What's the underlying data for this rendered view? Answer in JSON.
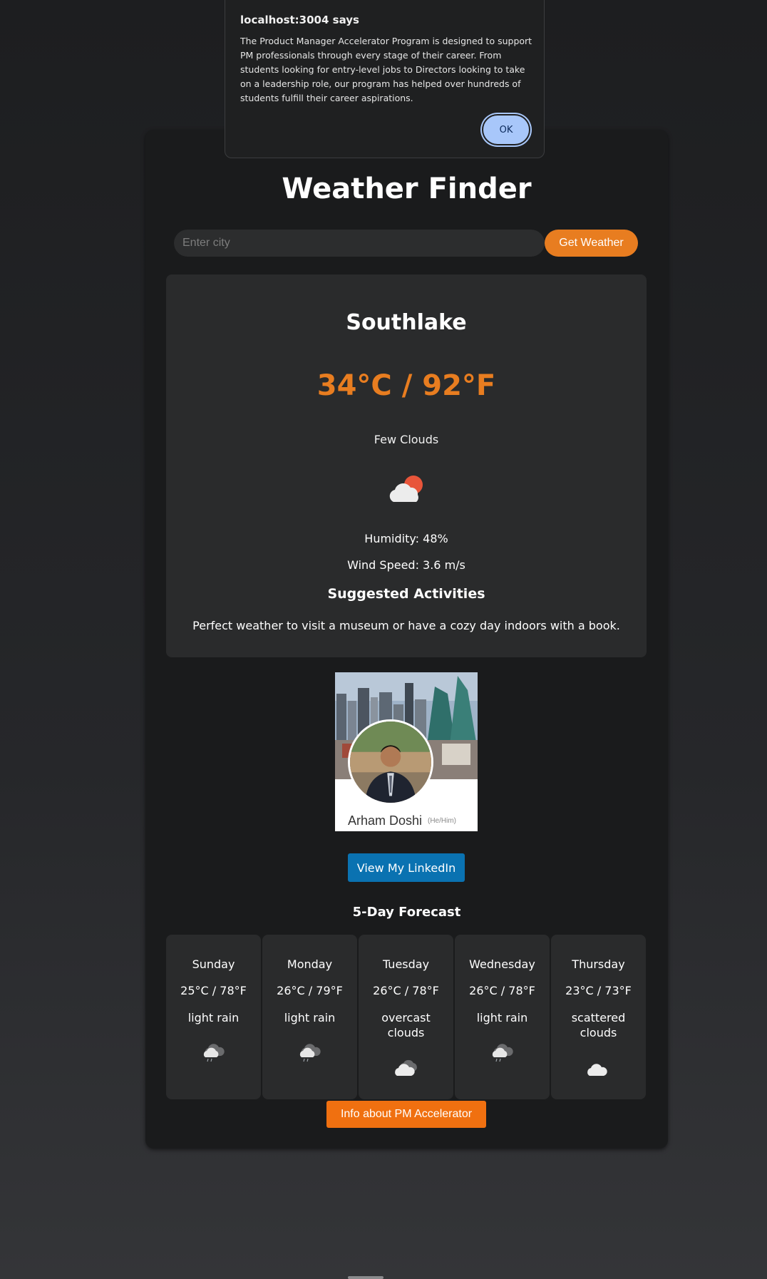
{
  "dialog": {
    "title": "localhost:3004 says",
    "message": "The Product Manager Accelerator Program is designed to support PM professionals through every stage of their career. From students looking for entry-level jobs to Directors looking to take on a leadership role, our program has helped over hundreds of students fulfill their career aspirations.",
    "ok_label": "OK"
  },
  "app": {
    "title": "Weather Finder",
    "search": {
      "placeholder": "Enter city",
      "value": "",
      "button_label": "Get Weather"
    }
  },
  "current": {
    "city": "Southlake",
    "temperature": "34°C / 92°F",
    "condition": "Few Clouds",
    "icon": "few-clouds-day-icon",
    "humidity": "Humidity: 48%",
    "wind": "Wind Speed: 3.6 m/s",
    "activities_title": "Suggested Activities",
    "activities_text": "Perfect weather to visit a museum or have a cozy day indoors with a book."
  },
  "profile": {
    "name": "Arham Doshi",
    "pronouns": "(He/Him)",
    "linkedin_label": "View My LinkedIn"
  },
  "forecast": {
    "title": "5-Day Forecast",
    "days": [
      {
        "day": "Sunday",
        "temp": "25°C / 78°F",
        "desc": "light rain",
        "icon": "light-rain-icon"
      },
      {
        "day": "Monday",
        "temp": "26°C / 79°F",
        "desc": "light rain",
        "icon": "light-rain-icon"
      },
      {
        "day": "Tuesday",
        "temp": "26°C / 78°F",
        "desc": "overcast clouds",
        "icon": "overcast-clouds-icon"
      },
      {
        "day": "Wednesday",
        "temp": "26°C / 78°F",
        "desc": "light rain",
        "icon": "light-rain-icon"
      },
      {
        "day": "Thursday",
        "temp": "23°C / 73°F",
        "desc": "scattered clouds",
        "icon": "scattered-clouds-icon"
      }
    ]
  },
  "pm_button_label": "Info about PM Accelerator",
  "colors": {
    "accent": "#e87d20",
    "linkedin": "#0a72b1",
    "pm_button": "#f07010",
    "dialog_button": "#a8c7fa"
  }
}
